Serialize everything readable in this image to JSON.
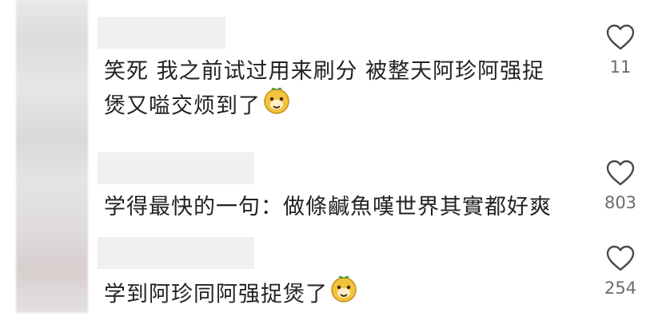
{
  "comments": [
    {
      "text_line1": "笑死  我之前试过用来刷分  被整天阿珍阿强捉",
      "text_line2": "煲又嗌交烦到了",
      "emoji": "smiling-dog-face-icon",
      "likes": "11"
    },
    {
      "text_line1": "学得最快的一句：做條鹹魚嘆世界其實都好爽",
      "likes": "803"
    },
    {
      "text_line1": "学到阿珍同阿强捉煲了",
      "emoji": "smiling-dog-face-icon",
      "likes": "254"
    }
  ],
  "colors": {
    "text": "#222222",
    "count": "#6b6b6b",
    "heart_outline": "#4a4a4a"
  }
}
